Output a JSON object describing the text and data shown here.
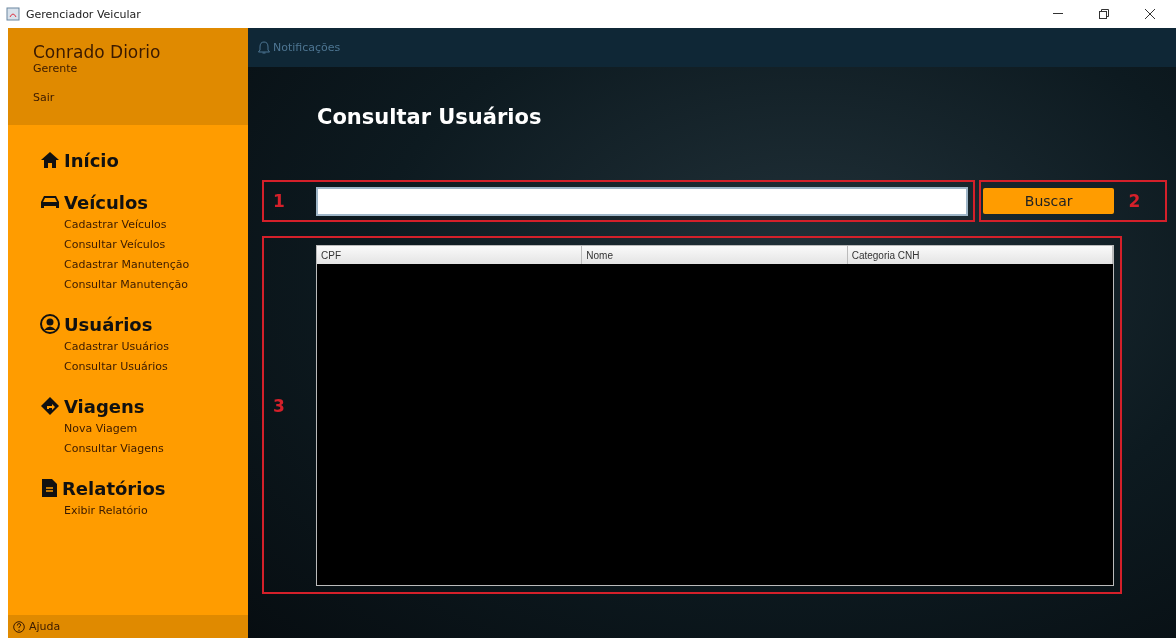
{
  "window": {
    "title": "Gerenciador Veicular"
  },
  "user": {
    "name": "Conrado Diorio",
    "role": "Gerente",
    "logout": "Sair"
  },
  "nav": [
    {
      "label": "Início"
    },
    {
      "label": "Veículos",
      "items": [
        "Cadastrar Veículos",
        "Consultar Veículos",
        "Cadastrar Manutenção",
        "Consultar Manutenção"
      ]
    },
    {
      "label": "Usuários",
      "items": [
        "Cadastrar Usuários",
        "Consultar Usuários"
      ]
    },
    {
      "label": "Viagens",
      "items": [
        "Nova Viagem",
        "Consultar Viagens"
      ]
    },
    {
      "label": "Relatórios",
      "items": [
        "Exibir Relatório"
      ]
    }
  ],
  "help": "Ajuda",
  "notifications": "Notificações",
  "page_title": "Consultar Usuários",
  "annotations": [
    "1",
    "2",
    "3"
  ],
  "search_button": "Buscar",
  "table": {
    "columns": [
      "CPF",
      "Nome",
      "Categoria CNH"
    ]
  }
}
